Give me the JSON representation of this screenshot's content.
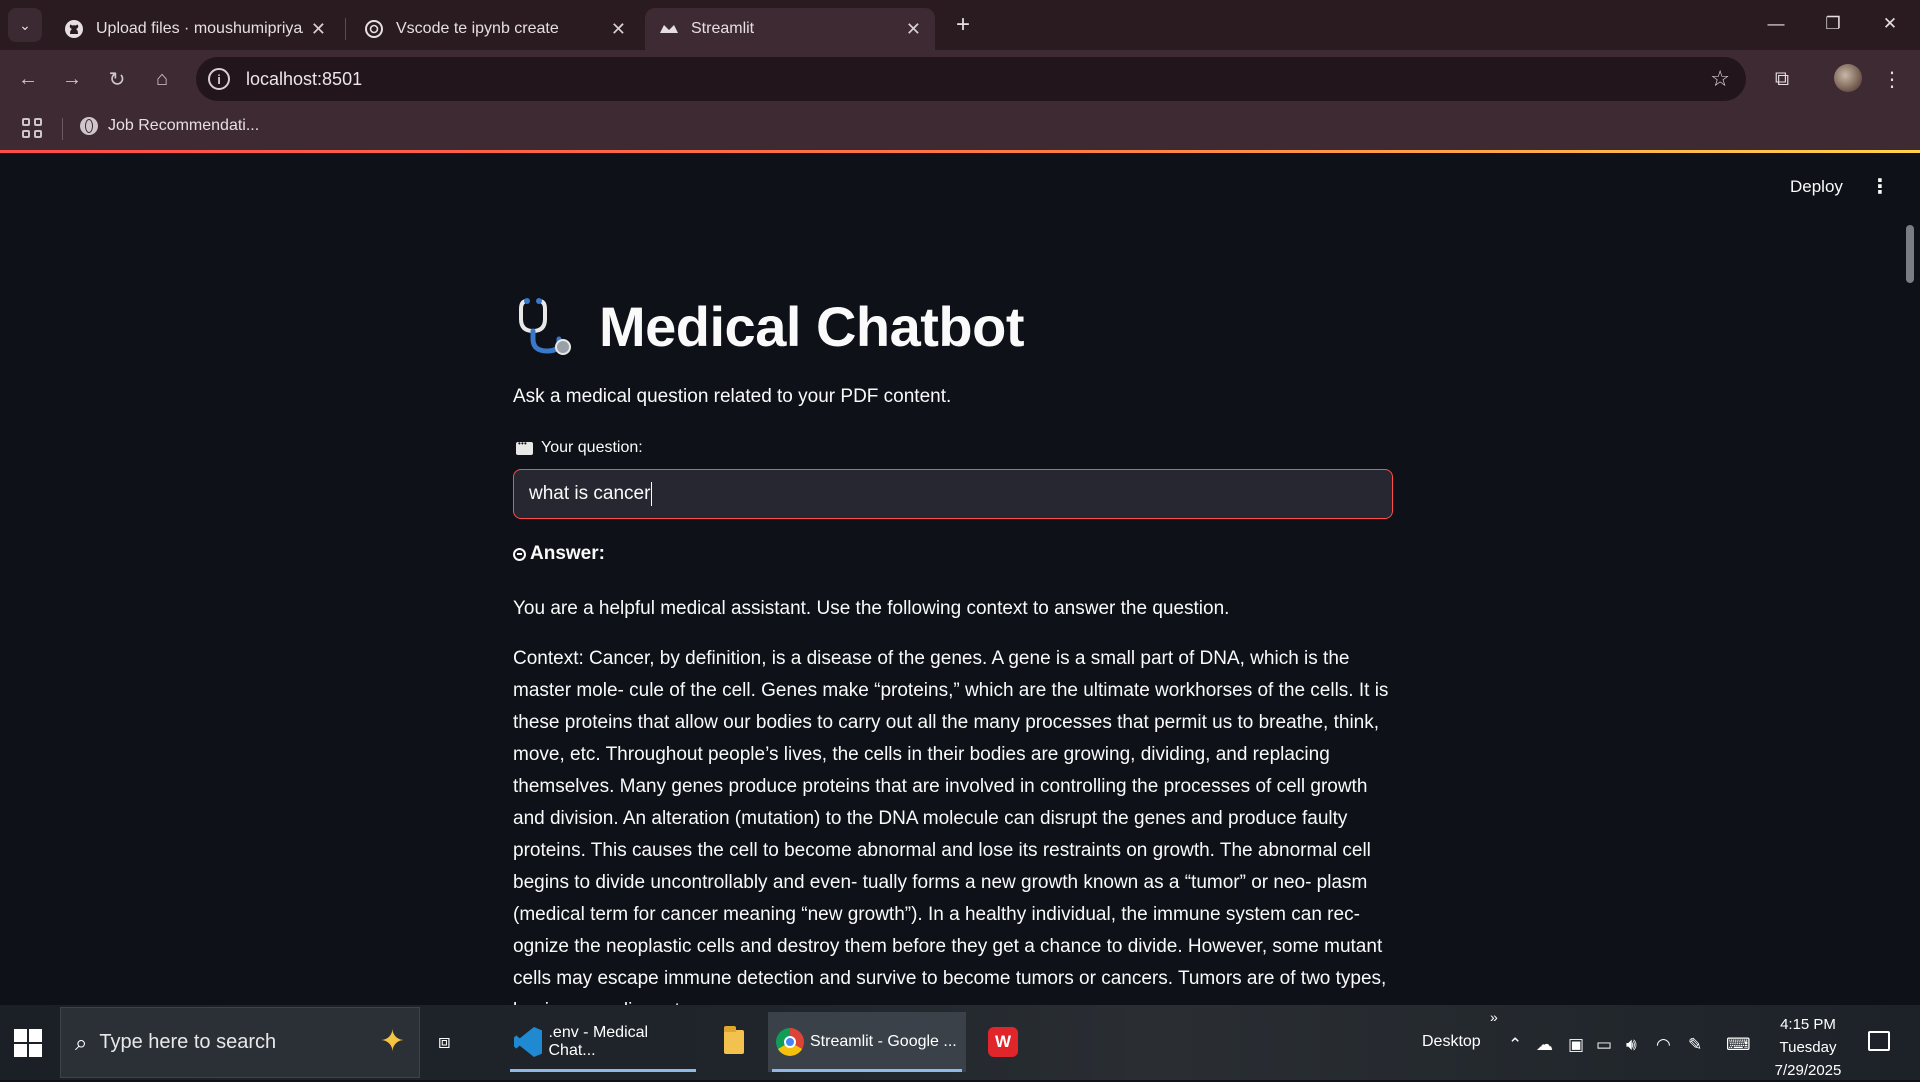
{
  "browser": {
    "tabs": [
      {
        "title": "Upload files · moushumipriya/M",
        "active": false
      },
      {
        "title": "Vscode te ipynb create",
        "active": false
      },
      {
        "title": "Streamlit",
        "active": true
      }
    ],
    "url": "localhost:8501",
    "bookmark": "Job Recommendati..."
  },
  "app": {
    "deploy_label": "Deploy",
    "menu_glyph": "⋮",
    "title": "Medical Chatbot",
    "subtitle": "Ask a medical question related to your PDF content.",
    "question_label": "Your question:",
    "question_value": "what is cancer",
    "answer_label": "Answer:",
    "answer_intro": "You are a helpful medical assistant. Use the following context to answer the question.",
    "answer_context": "Context: Cancer, by definition, is a disease of the genes. A gene is a small part of DNA, which is the master mole- cule of the cell. Genes make “proteins,” which are the ultimate workhorses of the cells. It is these proteins that allow our bodies to carry out all the many processes that permit us to breathe, think, move, etc. Throughout people’s lives, the cells in their bodies are growing, dividing, and replacing themselves. Many genes produce proteins that are involved in controlling the processes of cell growth and division. An alteration (mutation) to the DNA molecule can disrupt the genes and produce faulty proteins. This causes the cell to become abnormal and lose its restraints on growth. The abnormal cell begins to divide uncontrollably and even- tually forms a new growth known as a “tumor” or neo- plasm (medical term for cancer meaning “new growth”). In a healthy individual, the immune system can rec- ognize the neoplastic cells and destroy them before they get a chance to divide. However, some mutant cells may escape immune detection and survive to become tumors or cancers. Tumors are of two types, benign or malignant."
  },
  "taskbar": {
    "search_placeholder": "Type here to search",
    "apps": [
      {
        "label": ".env - Medical Chat...",
        "icon": "vscode-icon"
      },
      {
        "label": "",
        "icon": "file-explorer-icon"
      },
      {
        "label": "Streamlit - Google ...",
        "icon": "chrome-icon"
      },
      {
        "label": "",
        "icon": "wps-icon"
      }
    ],
    "desktop_label": "Desktop",
    "time": "4:15 PM",
    "day": "Tuesday",
    "date": "7/29/2025"
  },
  "colors": {
    "accent": "#ff4b4b",
    "app_bg": "#0e1117",
    "chrome_bg": "#3d2a33"
  }
}
